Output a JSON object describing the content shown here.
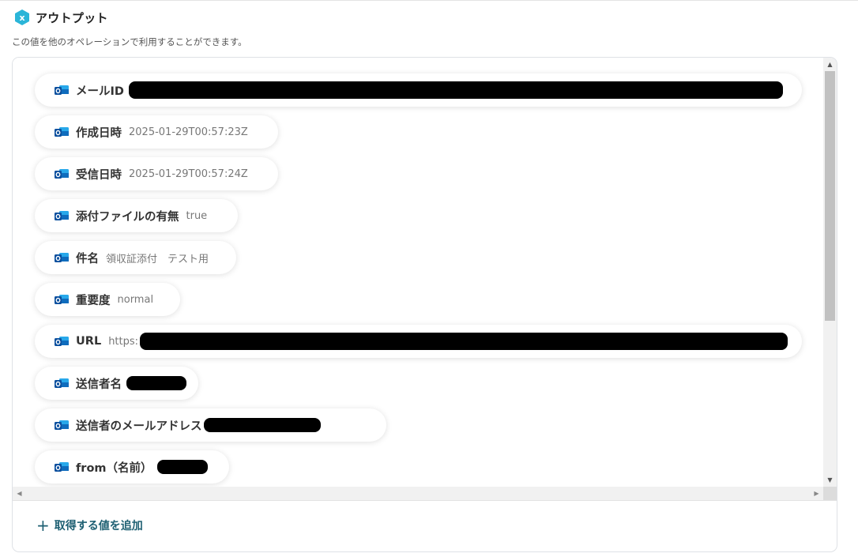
{
  "header": {
    "title": "アウトプット",
    "logo_icon": "yoom-x-hexagon-icon",
    "logo_letter": "x"
  },
  "subtitle": "この値を他のオペレーションで利用することができます。",
  "item_icon": "outlook-icon",
  "items": [
    {
      "label": "メールID",
      "value": "",
      "redacted": true
    },
    {
      "label": "作成日時",
      "value": "2025-01-29T00:57:23Z"
    },
    {
      "label": "受信日時",
      "value": "2025-01-29T00:57:24Z"
    },
    {
      "label": "添付ファイルの有無",
      "value": "true"
    },
    {
      "label": "件名",
      "value": "領収証添付　テスト用"
    },
    {
      "label": "重要度",
      "value": "normal"
    },
    {
      "label": "URL",
      "value": "https:",
      "redacted": true
    },
    {
      "label": "送信者名",
      "value": "",
      "redacted": true
    },
    {
      "label": "送信者のメールアドレス",
      "value": "",
      "redacted": true
    },
    {
      "label": "from（名前）",
      "value": "",
      "redacted": true
    }
  ],
  "add_button": {
    "label": "取得する値を追加",
    "icon": "plus-icon"
  },
  "colors": {
    "accent": "#1d5f72",
    "logo": "#2bb5d8",
    "outlook_blue": "#0f6cbd"
  }
}
